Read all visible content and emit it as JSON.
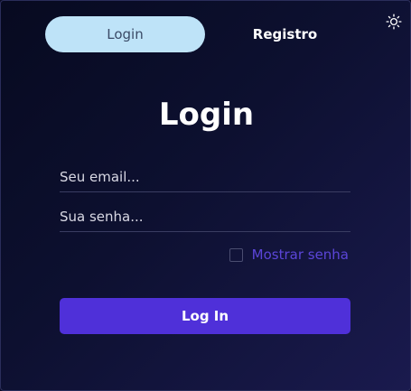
{
  "tabs": {
    "login_label": "Login",
    "register_label": "Registro"
  },
  "theme_toggle": {
    "icon": "sun-icon"
  },
  "form": {
    "title": "Login",
    "email_placeholder": "Seu email...",
    "email_value": "",
    "password_placeholder": "Sua senha...",
    "password_value": "",
    "show_password_label": "Mostrar senha",
    "show_password_checked": false,
    "submit_label": "Log In"
  },
  "colors": {
    "background_dark": "#070a20",
    "background_light": "#1a1a4e",
    "active_tab_bg": "#bee3f8",
    "accent": "#4f30d9",
    "link": "#5b45d8"
  }
}
